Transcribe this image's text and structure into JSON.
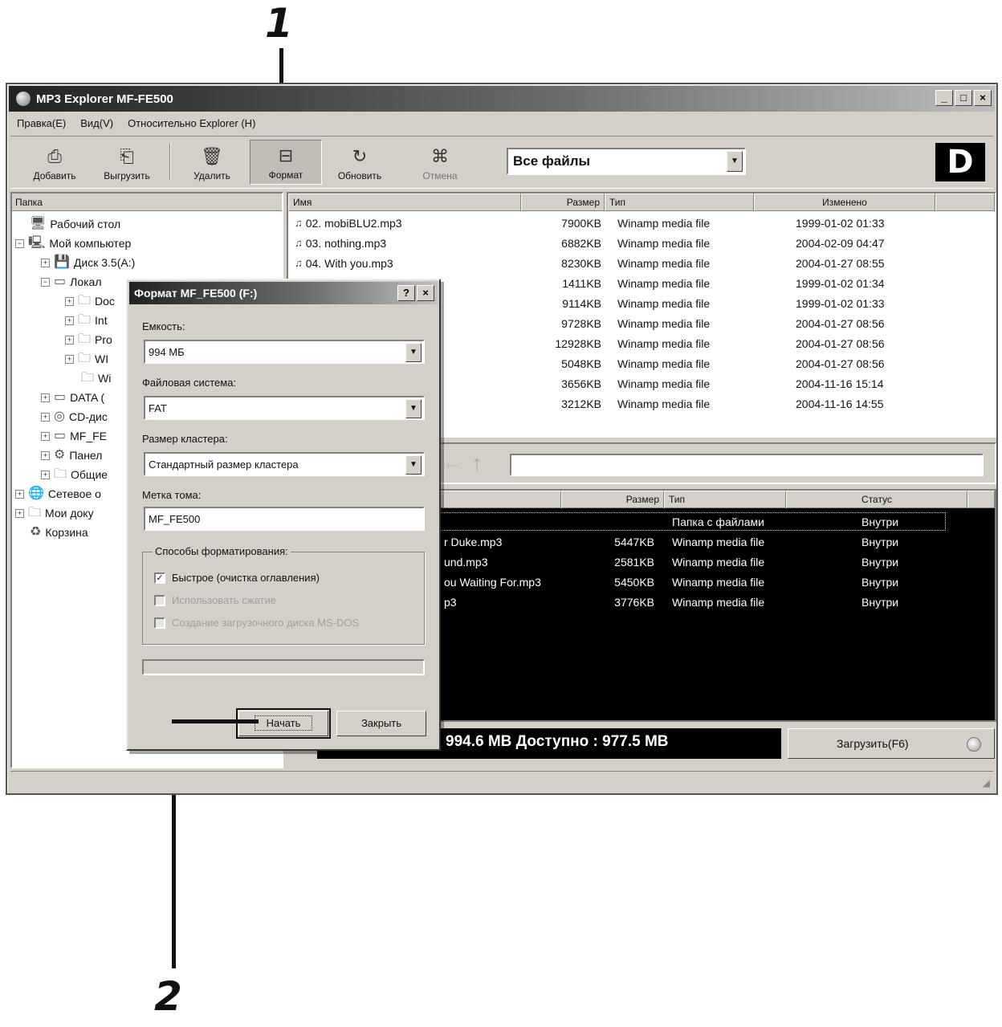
{
  "callouts": {
    "one": "1",
    "two": "2"
  },
  "window": {
    "title": "MP3 Explorer MF-FE500",
    "controls": [
      "_",
      "□",
      "×"
    ]
  },
  "menu": [
    "Правка(E)",
    "Вид(V)",
    "Относительно Explorer (H)"
  ],
  "toolbar": {
    "buttons": [
      {
        "label": "Добавить",
        "icon": "add-file-icon",
        "glyph": "⎙"
      },
      {
        "label": "Выгрузить",
        "icon": "export-icon",
        "glyph": "⎗"
      },
      {
        "label": "Удалить",
        "icon": "trash-icon",
        "glyph": "🗑"
      },
      {
        "label": "Формат",
        "icon": "format-icon",
        "glyph": "⊟"
      },
      {
        "label": "Обновить",
        "icon": "refresh-icon",
        "glyph": "↻"
      },
      {
        "label": "Отмена",
        "icon": "cancel-icon",
        "glyph": "⌘"
      }
    ],
    "filter": "Все файлы",
    "brand": "D"
  },
  "tree": {
    "header": "Папка",
    "items": [
      "Рабочий стол",
      "Мой компьютер",
      "Диск 3.5(A:)",
      "Локал",
      "Doc",
      "Int",
      "Pro",
      "WI",
      "Wi",
      "DATA (",
      "CD-дис",
      "MF_FE",
      "Панел",
      "Общие",
      "Сетевое о",
      "Мои доку",
      "Корзина"
    ]
  },
  "files": {
    "headers": [
      "Имя",
      "Размер",
      "Тип",
      "Изменено"
    ],
    "rows": [
      {
        "name": "02. mobiBLU2.mp3",
        "size": "7900KB",
        "type": "Winamp media file",
        "date": "1999-01-02 01:33"
      },
      {
        "name": "03. nothing.mp3",
        "size": "6882KB",
        "type": "Winamp media file",
        "date": "2004-02-09 04:47"
      },
      {
        "name": "04. With you.mp3",
        "size": "8230KB",
        "type": "Winamp media file",
        "date": "2004-01-27 08:55"
      },
      {
        "name": "",
        "size": "1411KB",
        "type": "Winamp media file",
        "date": "1999-01-02 01:34"
      },
      {
        "name": "",
        "size": "9114KB",
        "type": "Winamp media file",
        "date": "1999-01-02 01:33"
      },
      {
        "name": "",
        "size": "9728KB",
        "type": "Winamp media file",
        "date": "2004-01-27 08:56"
      },
      {
        "name": "",
        "size": "12928KB",
        "type": "Winamp media file",
        "date": "2004-01-27 08:56"
      },
      {
        "name": "",
        "size": "5048KB",
        "type": "Winamp media file",
        "date": "2004-01-27 08:56"
      },
      {
        "name": "",
        "size": "3656KB",
        "type": "Winamp media file",
        "date": "2004-11-16 15:14"
      },
      {
        "name": "",
        "size": "3212KB",
        "type": "Winamp media file",
        "date": "2004-11-16 14:55"
      }
    ]
  },
  "device": {
    "headers": [
      "",
      "Размер",
      "Тип",
      "Статус"
    ],
    "rows": [
      {
        "name": "",
        "size": "",
        "type": "Папка с файлами",
        "status": "Внутри"
      },
      {
        "name": "r Duke.mp3",
        "size": "5447KB",
        "type": "Winamp media file",
        "status": "Внутри"
      },
      {
        "name": "und.mp3",
        "size": "2581KB",
        "type": "Winamp media file",
        "status": "Внутри"
      },
      {
        "name": "ou Waiting For.mp3",
        "size": "5450KB",
        "type": "Winamp media file",
        "status": "Внутри"
      },
      {
        "name": "p3",
        "size": "3776KB",
        "type": "Winamp media file",
        "status": "Внутри"
      }
    ],
    "capacity": "994.6 MB   Доступно : 977.5 MB",
    "upload": "Загрузить(F6)"
  },
  "dialog": {
    "title": "Формат MF_FE500 (F:)",
    "title_buttons": [
      "?",
      "×"
    ],
    "capacity_label": "Емкость:",
    "capacity_value": "994 МБ",
    "fs_label": "Файловая система:",
    "fs_value": "FAT",
    "cluster_label": "Размер кластера:",
    "cluster_value": "Стандартный размер кластера",
    "volume_label": "Метка тома:",
    "volume_value": "MF_FE500",
    "options_legend": "Способы форматирования:",
    "opt_quick": "Быстрое (очистка оглавления)",
    "opt_compress": "Использовать сжатие",
    "opt_msdos": "Создание загрузочного диска MS-DOS",
    "start": "Начать",
    "close": "Закрыть"
  }
}
